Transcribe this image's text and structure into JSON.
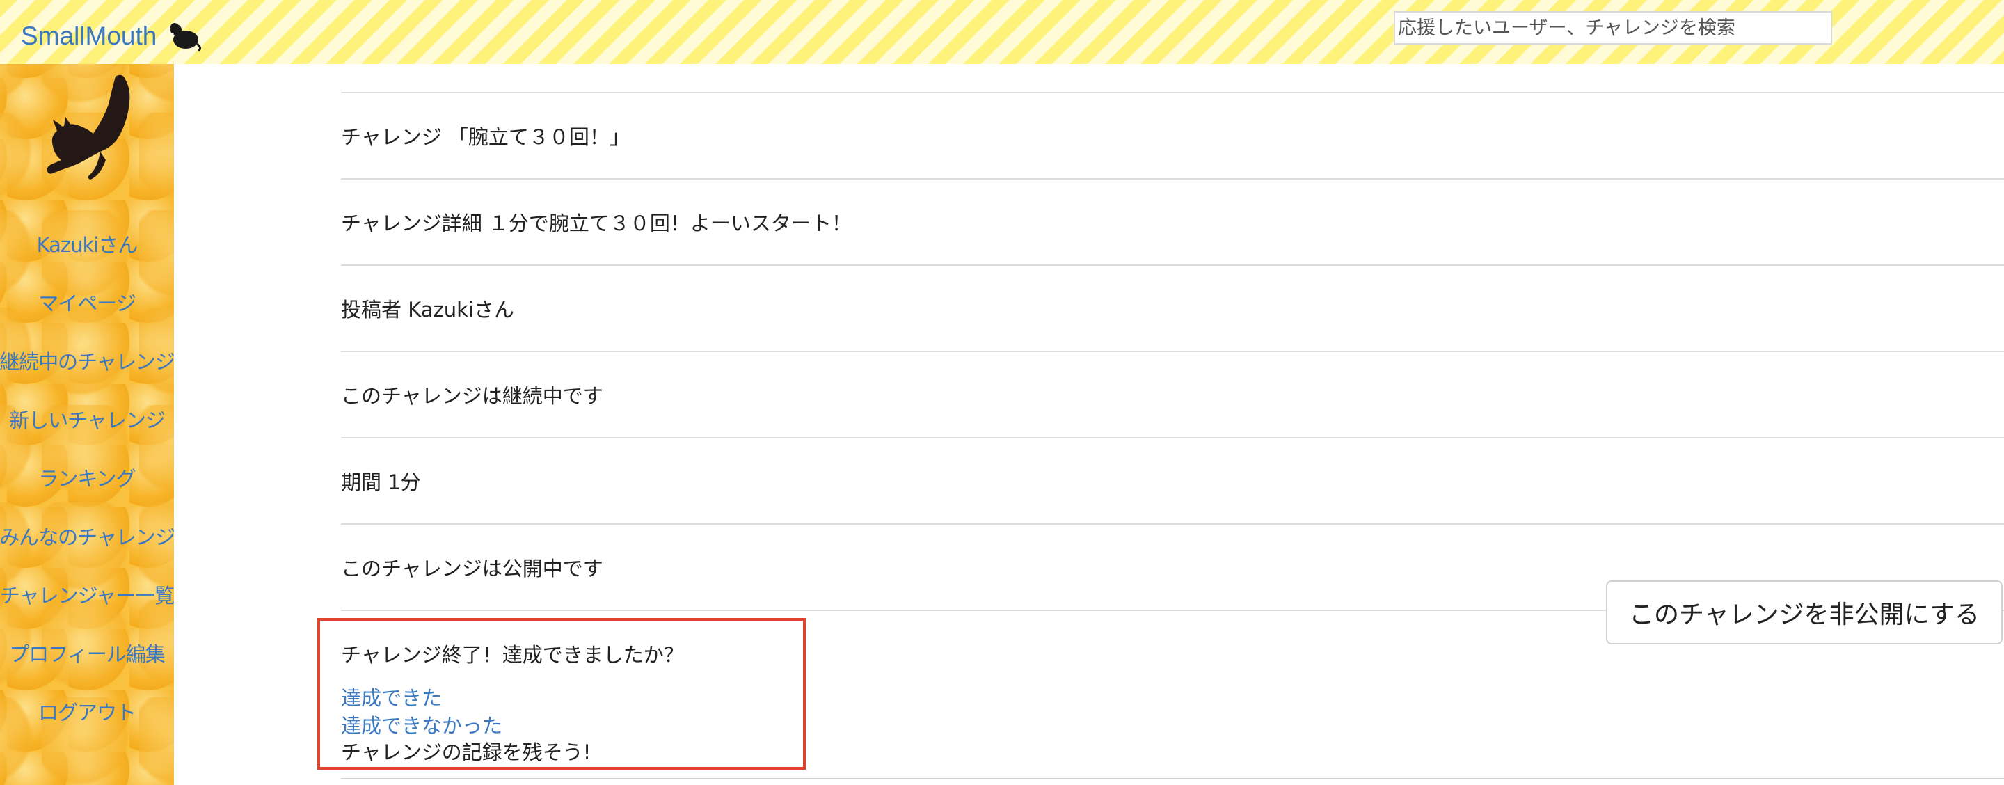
{
  "header": {
    "brand": "SmallMouth",
    "brand_icon": "mouse-icon",
    "search_placeholder": "応援したいユーザー、チャレンジを検索"
  },
  "sidebar": {
    "mascot_icon": "cat-icon",
    "items": [
      {
        "label": "Kazukiさん"
      },
      {
        "label": "マイページ"
      },
      {
        "label": "継続中のチャレンジ"
      },
      {
        "label": "新しいチャレンジ"
      },
      {
        "label": "ランキング"
      },
      {
        "label": "みんなのチャレンジ"
      },
      {
        "label": "チャレンジャー一覧"
      },
      {
        "label": "プロフィール編集"
      },
      {
        "label": "ログアウト"
      }
    ]
  },
  "challenge": {
    "title": "チャレンジ 「腕立て３０回！」",
    "detail": "チャレンジ詳細 １分で腕立て３０回！よーいスタート！",
    "author": "投稿者 Kazukiさん",
    "status": "このチャレンジは継続中です",
    "period": "期間 1分",
    "visibility": "このチャレンジは公開中です",
    "make_private_button": "このチャレンジを非公開にする"
  },
  "result": {
    "question": "チャレンジ終了！達成できましたか？",
    "achieved_link": "達成できた",
    "not_achieved_link": "達成できなかった",
    "record_prompt": "チャレンジの記録を残そう!"
  },
  "colors": {
    "link": "#3b78c2",
    "header_stripe": "#fff27a",
    "sidebar": "#f9c13d",
    "highlight_border": "#e0432c"
  }
}
